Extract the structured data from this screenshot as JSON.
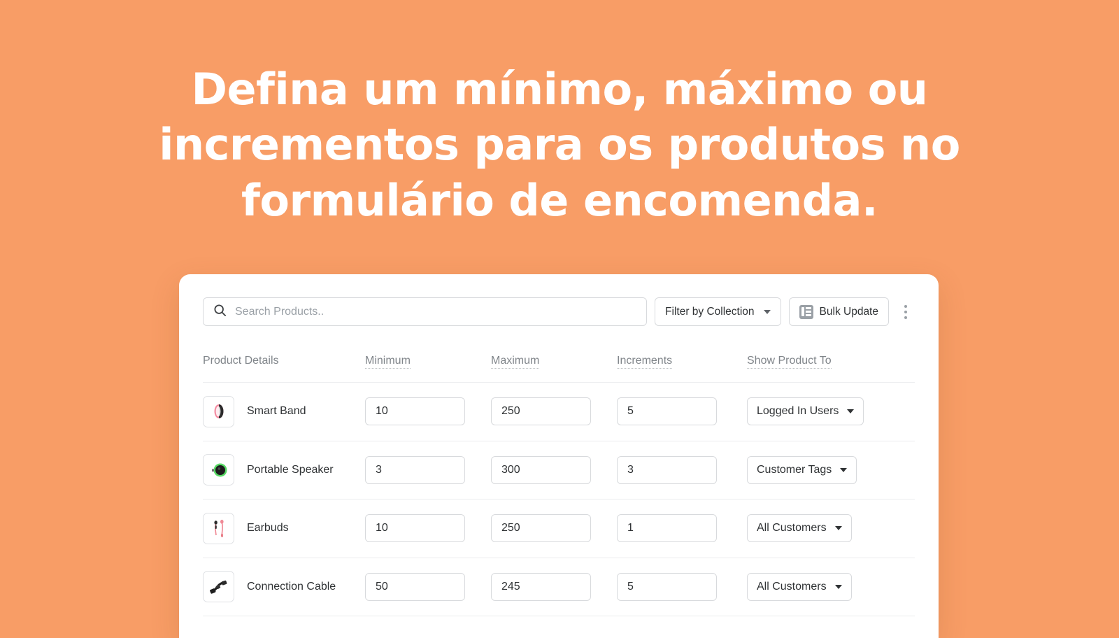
{
  "hero": {
    "headline": "Defina um mínimo, máximo ou incrementos para os produtos no formulário de encomenda."
  },
  "colors": {
    "background": "#F89D66",
    "card": "#FFFFFF",
    "text": "#2F3234",
    "muted": "#80858A",
    "border": "#D8DADD"
  },
  "toolbar": {
    "search_placeholder": "Search Products..",
    "search_value": "",
    "filter_label": "Filter by Collection",
    "bulk_update_label": "Bulk Update",
    "more_menu_label": ""
  },
  "table": {
    "headers": [
      {
        "label": "Product Details",
        "dotted": false
      },
      {
        "label": "Minimum",
        "dotted": true
      },
      {
        "label": "Maximum",
        "dotted": true
      },
      {
        "label": "Increments",
        "dotted": true
      },
      {
        "label": "Show Product To",
        "dotted": true
      }
    ],
    "rows": [
      {
        "product": "Smart Band",
        "minimum": "10",
        "maximum": "250",
        "increments": "5",
        "show_to": "Logged In Users",
        "thumb": "smart-band"
      },
      {
        "product": "Portable Speaker",
        "minimum": "3",
        "maximum": "300",
        "increments": "3",
        "show_to": "Customer Tags",
        "thumb": "portable-speaker"
      },
      {
        "product": "Earbuds",
        "minimum": "10",
        "maximum": "250",
        "increments": "1",
        "show_to": "All Customers",
        "thumb": "earbuds"
      },
      {
        "product": "Connection Cable",
        "minimum": "50",
        "maximum": "245",
        "increments": "5",
        "show_to": "All Customers",
        "thumb": "connection-cable"
      }
    ]
  }
}
